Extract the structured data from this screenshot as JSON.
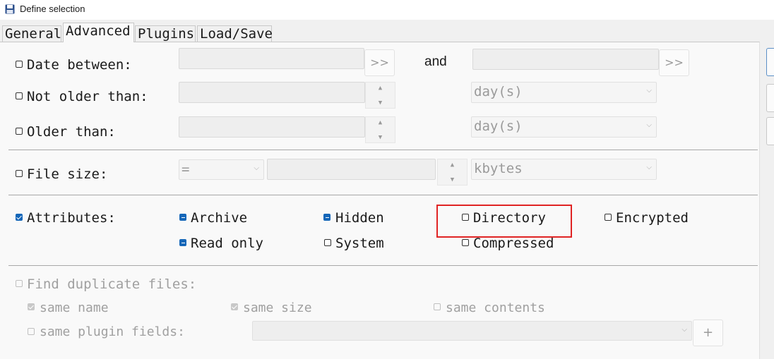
{
  "window": {
    "title": "Define selection",
    "icon": "floppy-disk-icon"
  },
  "tabs": [
    {
      "label": "General"
    },
    {
      "label": "Advanced"
    },
    {
      "label": "Plugins"
    },
    {
      "label": "Load/Save"
    }
  ],
  "date": {
    "label": "Date between:",
    "and_label": "and",
    "pick_button": ">>"
  },
  "not_older": {
    "label": "Not older than:",
    "unit": "day(s)"
  },
  "older": {
    "label": "Older than:",
    "unit": "day(s)"
  },
  "filesize": {
    "label": "File size:",
    "operator": "=",
    "unit": "kbytes"
  },
  "attributes": {
    "label": "Attributes:",
    "archive": "Archive",
    "hidden": "Hidden",
    "directory": "Directory",
    "encrypted": "Encrypted",
    "read_only": "Read only",
    "system": "System",
    "compressed": "Compressed"
  },
  "duplicates": {
    "label": "Find duplicate files:",
    "same_name": "same name",
    "same_size": "same size",
    "same_contents": "same contents",
    "same_plugin_fields": "same plugin fields:",
    "add_button": "+"
  },
  "colors": {
    "highlight": "#e02424",
    "accent": "#1466b8"
  }
}
